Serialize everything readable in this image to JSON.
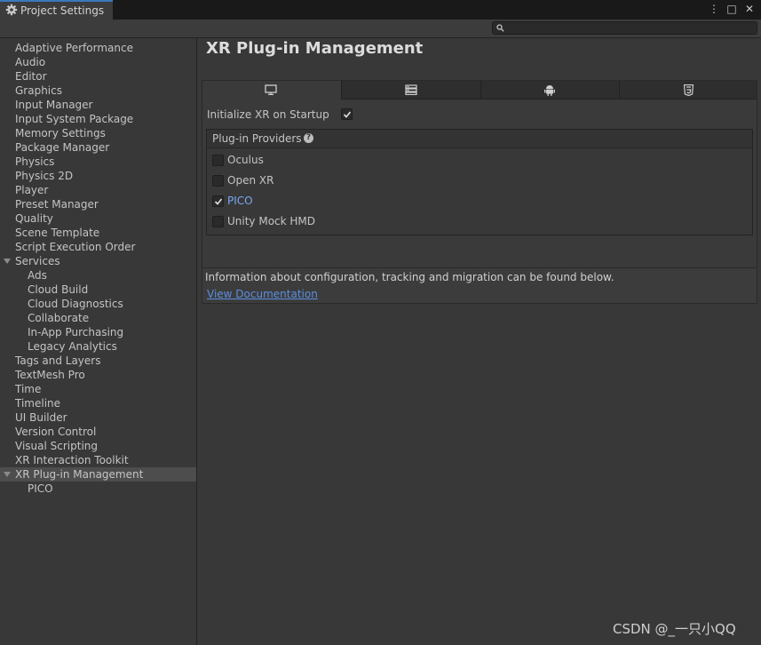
{
  "window": {
    "tab_title": "Project Settings",
    "icon": "gear-icon"
  },
  "toolbar": {
    "search_placeholder": "",
    "menu_icon": "⋮",
    "maximize_icon": "□",
    "close_icon": "✕"
  },
  "sidebar": {
    "items": [
      {
        "label": "Adaptive Performance",
        "indent": 0
      },
      {
        "label": "Audio",
        "indent": 0
      },
      {
        "label": "Editor",
        "indent": 0
      },
      {
        "label": "Graphics",
        "indent": 0
      },
      {
        "label": "Input Manager",
        "indent": 0
      },
      {
        "label": "Input System Package",
        "indent": 0
      },
      {
        "label": "Memory Settings",
        "indent": 0
      },
      {
        "label": "Package Manager",
        "indent": 0
      },
      {
        "label": "Physics",
        "indent": 0
      },
      {
        "label": "Physics 2D",
        "indent": 0
      },
      {
        "label": "Player",
        "indent": 0
      },
      {
        "label": "Preset Manager",
        "indent": 0
      },
      {
        "label": "Quality",
        "indent": 0
      },
      {
        "label": "Scene Template",
        "indent": 0
      },
      {
        "label": "Script Execution Order",
        "indent": 0
      },
      {
        "label": "Services",
        "indent": 0,
        "expanded": true
      },
      {
        "label": "Ads",
        "indent": 1
      },
      {
        "label": "Cloud Build",
        "indent": 1
      },
      {
        "label": "Cloud Diagnostics",
        "indent": 1
      },
      {
        "label": "Collaborate",
        "indent": 1
      },
      {
        "label": "In-App Purchasing",
        "indent": 1
      },
      {
        "label": "Legacy Analytics",
        "indent": 1
      },
      {
        "label": "Tags and Layers",
        "indent": 0
      },
      {
        "label": "TextMesh Pro",
        "indent": 0
      },
      {
        "label": "Time",
        "indent": 0
      },
      {
        "label": "Timeline",
        "indent": 0
      },
      {
        "label": "UI Builder",
        "indent": 0
      },
      {
        "label": "Version Control",
        "indent": 0
      },
      {
        "label": "Visual Scripting",
        "indent": 0
      },
      {
        "label": "XR Interaction Toolkit",
        "indent": 0
      },
      {
        "label": "XR Plug-in Management",
        "indent": 0,
        "expanded": true,
        "selected": true
      },
      {
        "label": "PICO",
        "indent": 1
      }
    ]
  },
  "main": {
    "title": "XR Plug-in Management",
    "platform_tabs": [
      {
        "icon": "desktop-icon",
        "active": true
      },
      {
        "icon": "server-icon",
        "active": false
      },
      {
        "icon": "android-icon",
        "active": false
      },
      {
        "icon": "html5-icon",
        "active": false
      }
    ],
    "init_xr_label": "Initialize XR on Startup",
    "init_xr_checked": true,
    "providers_header": "Plug-in Providers",
    "help_icon": "?",
    "providers": [
      {
        "label": "Oculus",
        "checked": false
      },
      {
        "label": "Open XR",
        "checked": false
      },
      {
        "label": "PICO",
        "checked": true
      },
      {
        "label": "Unity Mock HMD",
        "checked": false
      }
    ],
    "info_text": "Information about configuration, tracking and migration can be found below.",
    "info_link": "View Documentation"
  },
  "watermark": "CSDN @_一只小QQ"
}
